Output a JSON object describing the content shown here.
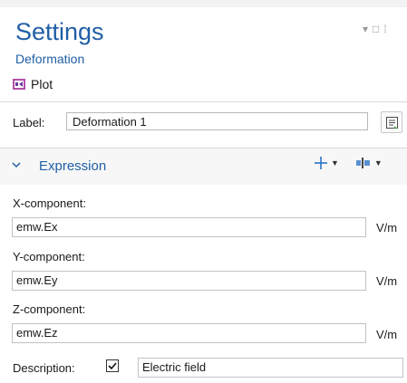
{
  "header": {
    "title": "Settings",
    "subtitle": "Deformation"
  },
  "toolbar": {
    "plot_label": "Plot"
  },
  "label_row": {
    "label": "Label:",
    "value": "Deformation 1"
  },
  "section": {
    "title": "Expression"
  },
  "components": [
    {
      "label": "X-component:",
      "value": "emw.Ex",
      "unit": "V/m"
    },
    {
      "label": "Y-component:",
      "value": "emw.Ey",
      "unit": "V/m"
    },
    {
      "label": "Z-component:",
      "value": "emw.Ez",
      "unit": "V/m"
    }
  ],
  "description": {
    "label": "Description:",
    "checked": true,
    "value": "Electric field"
  },
  "colors": {
    "accent": "#1f5fa6",
    "plus": "#2a73c9"
  },
  "icons": [
    "pin-icon",
    "maximize-icon",
    "dropdown-arrow-icon",
    "plot-icon",
    "label-settings-icon",
    "chevron-down-icon",
    "plus-icon",
    "insert-expression-icon",
    "checkmark-icon"
  ]
}
